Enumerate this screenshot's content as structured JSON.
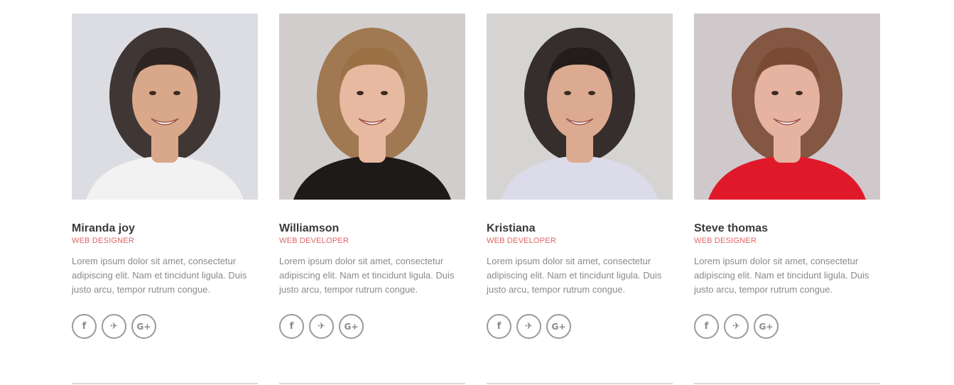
{
  "team": [
    {
      "name": "Miranda joy",
      "role": "WEB DESIGNER",
      "description": "Lorem ipsum dolor sit amet, consectetur adipiscing elit. Nam et tincidunt ligula. Duis justo arcu, tempor rutrum congue.",
      "photo": {
        "bg": "#dcdde3",
        "skin": "#d9a789",
        "hair": "#2f2520",
        "shirt": "#f2f2f2"
      }
    },
    {
      "name": "Williamson",
      "role": "WEB DEVELOPER",
      "description": "Lorem ipsum dolor sit amet, consectetur adipiscing elit. Nam et tincidunt ligula. Duis justo arcu, tempor rutrum congue.",
      "photo": {
        "bg": "#d2cdcd",
        "skin": "#e6b9a0",
        "hair": "#9a7045",
        "shirt": "#1f1a1a"
      }
    },
    {
      "name": "Kristiana",
      "role": "WEB DEVELOPER",
      "description": "Lorem ipsum dolor sit amet, consectetur adipiscing elit. Nam et tincidunt ligula. Duis justo arcu, tempor rutrum congue.",
      "photo": {
        "bg": "#d5d4d2",
        "skin": "#dcaa90",
        "hair": "#231c1a",
        "shirt": "#dcdbea"
      }
    },
    {
      "name": "Steve thomas",
      "role": "WEB DESIGNER",
      "description": "Lorem ipsum dolor sit amet, consectetur adipiscing elit. Nam et tincidunt ligula. Duis justo arcu, tempor rutrum congue.",
      "photo": {
        "bg": "#cfc9cb",
        "skin": "#e6b3a0",
        "hair": "#7a4a32",
        "shirt": "#e0192a"
      }
    }
  ],
  "socials": [
    {
      "icon": "facebook-icon",
      "glyph": "f"
    },
    {
      "icon": "twitter-icon",
      "glyph": "✈"
    },
    {
      "icon": "google-plus-icon",
      "glyph": "G+"
    }
  ],
  "colors": {
    "accent": "#e06565",
    "text": "#3a3a3a",
    "muted": "#8a8a8a"
  }
}
